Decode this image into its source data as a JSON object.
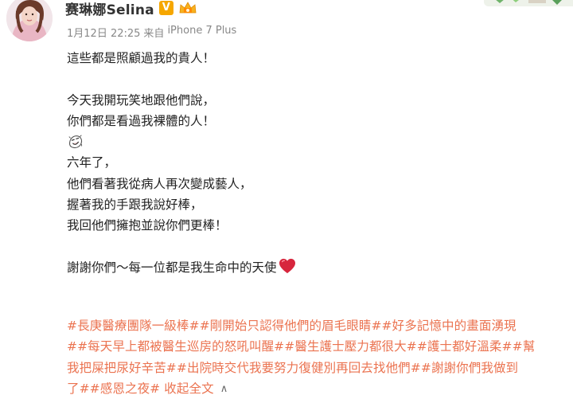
{
  "user": {
    "name": "赛琳娜Selina",
    "verified_mark": "V"
  },
  "meta": {
    "time": "1月12日 22:25",
    "source_prefix": "来自",
    "source": "iPhone 7 Plus"
  },
  "post": {
    "lines": [
      "這些都是照顧過我的貴人！",
      "",
      "今天我開玩笑地跟他們說，",
      "你們都是看過我裸體的人！",
      "",
      "六年了，",
      "他們看著我從病人再次變成藝人，",
      "握著我的手跟我說好棒，",
      "我回他們擁抱並說你們更棒！",
      "",
      "謝謝你們～每一位都是我生命中的天使"
    ],
    "emoji_icon": "laughing-face-emoji",
    "heart_icon": "red-heart-emoji"
  },
  "hashtags": {
    "lines": [
      "#長庚醫療團隊一級棒##剛開始只認得他們的眉毛眼睛##好多記憶中的畫面湧現",
      "##每天早上都被醫生巡房的怒吼叫醒##醫生護士壓力都很大##護士都好溫柔##幫",
      "我把屎把尿好辛苦##出院時交代我要努力復健別再回去找他們##謝謝你們我做到",
      "了##感恩之夜#"
    ],
    "collapse_label": "收起全文",
    "collapse_arrow": "∧"
  },
  "colors": {
    "hashtag": "#eb7350",
    "meta": "#888888",
    "text": "#222222",
    "verified": "#f6a700",
    "heart": "#d7263d"
  }
}
